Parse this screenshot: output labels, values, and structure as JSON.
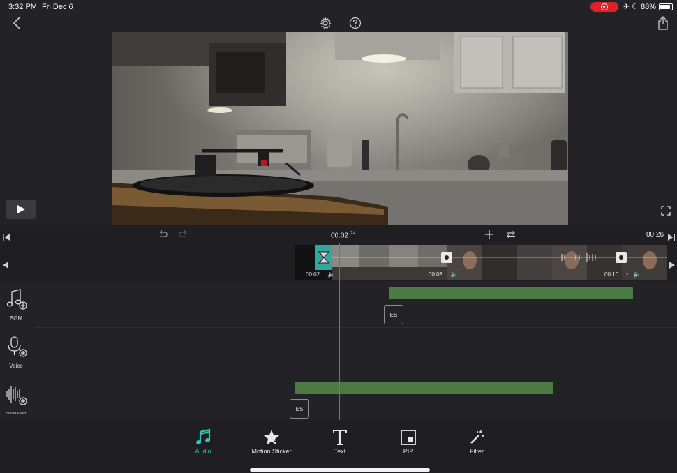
{
  "status": {
    "time": "3:32 PM",
    "date": "Fri Dec 6",
    "battery_text": "88%",
    "battery_level": 0.88
  },
  "timeline": {
    "current_time": "00:02",
    "current_frame": "24",
    "duration": "00:26"
  },
  "clips": [
    {
      "time": "00:02"
    },
    {
      "time": "00:08"
    },
    {
      "time": "00:10"
    }
  ],
  "tracks": {
    "bgm": {
      "label": "BGM",
      "tag": "ES"
    },
    "voice": {
      "label": "Voice"
    },
    "sound_effect": {
      "label": "Sound Effect",
      "tag": "ES"
    }
  },
  "tabs": [
    {
      "label": "Audio",
      "icon": "music-note-icon",
      "active": true
    },
    {
      "label": "Motion Sticker",
      "icon": "star-sticker-icon",
      "active": false
    },
    {
      "label": "Text",
      "icon": "text-icon",
      "active": false
    },
    {
      "label": "PIP",
      "icon": "pip-icon",
      "active": false
    },
    {
      "label": "Filter",
      "icon": "magic-wand-icon",
      "active": false
    }
  ],
  "colors": {
    "accent": "#35c4b8",
    "playhead": "#d44b4b",
    "audio_bar": "#4c7a45",
    "record": "#e0212b"
  }
}
